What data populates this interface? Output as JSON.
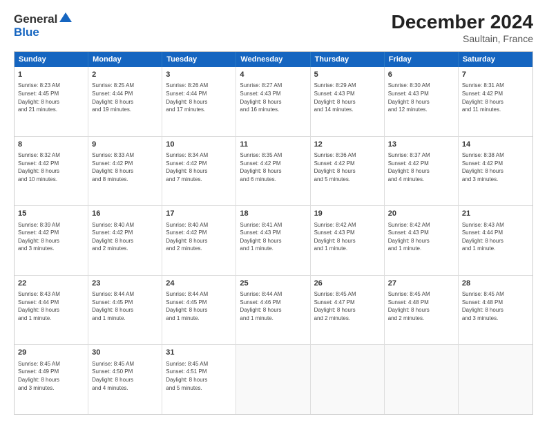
{
  "header": {
    "logo_general": "General",
    "logo_blue": "Blue",
    "month_title": "December 2024",
    "subtitle": "Saultain, France"
  },
  "calendar": {
    "days": [
      "Sunday",
      "Monday",
      "Tuesday",
      "Wednesday",
      "Thursday",
      "Friday",
      "Saturday"
    ],
    "rows": [
      [
        {
          "day": "1",
          "info": "Sunrise: 8:23 AM\nSunset: 4:45 PM\nDaylight: 8 hours\nand 21 minutes."
        },
        {
          "day": "2",
          "info": "Sunrise: 8:25 AM\nSunset: 4:44 PM\nDaylight: 8 hours\nand 19 minutes."
        },
        {
          "day": "3",
          "info": "Sunrise: 8:26 AM\nSunset: 4:44 PM\nDaylight: 8 hours\nand 17 minutes."
        },
        {
          "day": "4",
          "info": "Sunrise: 8:27 AM\nSunset: 4:43 PM\nDaylight: 8 hours\nand 16 minutes."
        },
        {
          "day": "5",
          "info": "Sunrise: 8:29 AM\nSunset: 4:43 PM\nDaylight: 8 hours\nand 14 minutes."
        },
        {
          "day": "6",
          "info": "Sunrise: 8:30 AM\nSunset: 4:43 PM\nDaylight: 8 hours\nand 12 minutes."
        },
        {
          "day": "7",
          "info": "Sunrise: 8:31 AM\nSunset: 4:42 PM\nDaylight: 8 hours\nand 11 minutes."
        }
      ],
      [
        {
          "day": "8",
          "info": "Sunrise: 8:32 AM\nSunset: 4:42 PM\nDaylight: 8 hours\nand 10 minutes."
        },
        {
          "day": "9",
          "info": "Sunrise: 8:33 AM\nSunset: 4:42 PM\nDaylight: 8 hours\nand 8 minutes."
        },
        {
          "day": "10",
          "info": "Sunrise: 8:34 AM\nSunset: 4:42 PM\nDaylight: 8 hours\nand 7 minutes."
        },
        {
          "day": "11",
          "info": "Sunrise: 8:35 AM\nSunset: 4:42 PM\nDaylight: 8 hours\nand 6 minutes."
        },
        {
          "day": "12",
          "info": "Sunrise: 8:36 AM\nSunset: 4:42 PM\nDaylight: 8 hours\nand 5 minutes."
        },
        {
          "day": "13",
          "info": "Sunrise: 8:37 AM\nSunset: 4:42 PM\nDaylight: 8 hours\nand 4 minutes."
        },
        {
          "day": "14",
          "info": "Sunrise: 8:38 AM\nSunset: 4:42 PM\nDaylight: 8 hours\nand 3 minutes."
        }
      ],
      [
        {
          "day": "15",
          "info": "Sunrise: 8:39 AM\nSunset: 4:42 PM\nDaylight: 8 hours\nand 3 minutes."
        },
        {
          "day": "16",
          "info": "Sunrise: 8:40 AM\nSunset: 4:42 PM\nDaylight: 8 hours\nand 2 minutes."
        },
        {
          "day": "17",
          "info": "Sunrise: 8:40 AM\nSunset: 4:42 PM\nDaylight: 8 hours\nand 2 minutes."
        },
        {
          "day": "18",
          "info": "Sunrise: 8:41 AM\nSunset: 4:43 PM\nDaylight: 8 hours\nand 1 minute."
        },
        {
          "day": "19",
          "info": "Sunrise: 8:42 AM\nSunset: 4:43 PM\nDaylight: 8 hours\nand 1 minute."
        },
        {
          "day": "20",
          "info": "Sunrise: 8:42 AM\nSunset: 4:43 PM\nDaylight: 8 hours\nand 1 minute."
        },
        {
          "day": "21",
          "info": "Sunrise: 8:43 AM\nSunset: 4:44 PM\nDaylight: 8 hours\nand 1 minute."
        }
      ],
      [
        {
          "day": "22",
          "info": "Sunrise: 8:43 AM\nSunset: 4:44 PM\nDaylight: 8 hours\nand 1 minute."
        },
        {
          "day": "23",
          "info": "Sunrise: 8:44 AM\nSunset: 4:45 PM\nDaylight: 8 hours\nand 1 minute."
        },
        {
          "day": "24",
          "info": "Sunrise: 8:44 AM\nSunset: 4:45 PM\nDaylight: 8 hours\nand 1 minute."
        },
        {
          "day": "25",
          "info": "Sunrise: 8:44 AM\nSunset: 4:46 PM\nDaylight: 8 hours\nand 1 minute."
        },
        {
          "day": "26",
          "info": "Sunrise: 8:45 AM\nSunset: 4:47 PM\nDaylight: 8 hours\nand 2 minutes."
        },
        {
          "day": "27",
          "info": "Sunrise: 8:45 AM\nSunset: 4:48 PM\nDaylight: 8 hours\nand 2 minutes."
        },
        {
          "day": "28",
          "info": "Sunrise: 8:45 AM\nSunset: 4:48 PM\nDaylight: 8 hours\nand 3 minutes."
        }
      ],
      [
        {
          "day": "29",
          "info": "Sunrise: 8:45 AM\nSunset: 4:49 PM\nDaylight: 8 hours\nand 3 minutes."
        },
        {
          "day": "30",
          "info": "Sunrise: 8:45 AM\nSunset: 4:50 PM\nDaylight: 8 hours\nand 4 minutes."
        },
        {
          "day": "31",
          "info": "Sunrise: 8:45 AM\nSunset: 4:51 PM\nDaylight: 8 hours\nand 5 minutes."
        },
        {
          "day": "",
          "info": ""
        },
        {
          "day": "",
          "info": ""
        },
        {
          "day": "",
          "info": ""
        },
        {
          "day": "",
          "info": ""
        }
      ]
    ]
  }
}
